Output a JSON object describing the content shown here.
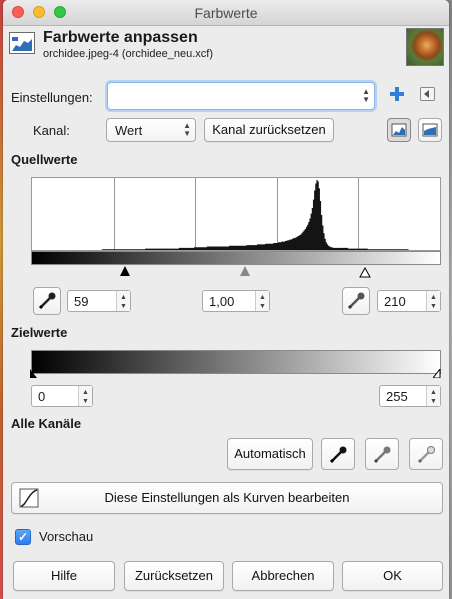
{
  "window": {
    "title": "Farbwerte"
  },
  "header": {
    "title": "Farbwerte anpassen",
    "subtitle": "orchidee.jpeg-4 (orchidee_neu.xcf)"
  },
  "settings": {
    "label": "Einstellungen:",
    "value": ""
  },
  "channel": {
    "label": "Kanal:",
    "value": "Wert",
    "reset_label": "Kanal zurücksetzen"
  },
  "source": {
    "title": "Quellwerte",
    "low": "59",
    "gamma": "1,00",
    "high": "210",
    "histogram": [
      0,
      0,
      0,
      0,
      0,
      0,
      0,
      0,
      0,
      0,
      0,
      0,
      0,
      0,
      0,
      0,
      0,
      0,
      0,
      0,
      0,
      0,
      0,
      0,
      0,
      0,
      0,
      0,
      0,
      0,
      0,
      0,
      0,
      0,
      0,
      0,
      0,
      0,
      0,
      0,
      0,
      0,
      0,
      0,
      0,
      0,
      0,
      0,
      0,
      0,
      0,
      0,
      0,
      0,
      0,
      0,
      0,
      0,
      0,
      0,
      1,
      1,
      1,
      1,
      1,
      1,
      1,
      1,
      1,
      1,
      1,
      1,
      1,
      1,
      1,
      1,
      1,
      1,
      1,
      1,
      1,
      1,
      1,
      1,
      1,
      1,
      1,
      1,
      1,
      1,
      1,
      1,
      1,
      1,
      1,
      1,
      1,
      2,
      2,
      2,
      2,
      2,
      2,
      2,
      2,
      2,
      2,
      2,
      2,
      2,
      2,
      2,
      2,
      2,
      2,
      2,
      2,
      2,
      2,
      2,
      2,
      2,
      2,
      2,
      2,
      2,
      3,
      3,
      3,
      3,
      3,
      3,
      3,
      3,
      3,
      3,
      3,
      3,
      3,
      4,
      4,
      4,
      4,
      4,
      4,
      4,
      4,
      4,
      4,
      4,
      5,
      5,
      5,
      5,
      5,
      5,
      5,
      5,
      5,
      5,
      5,
      5,
      5,
      5,
      5,
      5,
      5,
      5,
      5,
      6,
      6,
      6,
      6,
      6,
      6,
      6,
      6,
      6,
      6,
      6,
      6,
      6,
      6,
      6,
      7,
      7,
      7,
      7,
      7,
      7,
      7,
      7,
      7,
      8,
      8,
      8,
      8,
      8,
      8,
      8,
      9,
      9,
      9,
      9,
      9,
      9,
      9,
      10,
      10,
      10,
      10,
      11,
      11,
      11,
      12,
      12,
      12,
      13,
      13,
      14,
      14,
      15,
      15,
      16,
      17,
      17,
      18,
      19,
      20,
      21,
      22,
      24,
      26,
      28,
      30,
      33,
      36,
      40,
      45,
      52,
      60,
      72,
      85,
      95,
      100,
      98,
      88,
      70,
      50,
      35,
      24,
      16,
      11,
      8,
      6,
      5,
      4,
      4,
      3,
      3,
      3,
      3,
      3,
      3,
      3,
      3,
      3,
      3,
      3,
      3,
      3,
      2,
      2,
      2,
      2,
      2,
      2,
      2,
      2,
      2,
      2,
      2,
      2,
      2,
      2,
      2,
      2,
      2,
      1,
      1,
      1,
      1,
      1,
      1,
      1,
      1,
      1,
      1,
      1,
      1,
      1,
      1,
      1,
      1,
      1,
      1,
      1,
      1,
      1,
      1,
      1,
      1,
      1,
      1,
      1,
      1,
      1,
      1,
      1,
      1,
      1,
      1,
      1,
      0,
      0,
      0,
      0,
      0,
      0,
      0,
      0,
      0,
      0,
      0,
      0,
      0,
      0,
      0,
      0,
      0,
      0,
      0,
      0,
      0,
      0,
      0,
      0,
      0,
      0,
      0
    ]
  },
  "target": {
    "title": "Zielwerte",
    "low": "0",
    "high": "255"
  },
  "all_channels": {
    "title": "Alle Kanäle",
    "auto_label": "Automatisch"
  },
  "curves_label": "Diese Einstellungen als Kurven bearbeiten",
  "preview": {
    "label": "Vorschau",
    "checked": true
  },
  "footer": {
    "help": "Hilfe",
    "reset": "Zurücksetzen",
    "cancel": "Abbrechen",
    "ok": "OK"
  },
  "colors": {
    "accent": "#2a7ef0",
    "focus": "#b6d1f5"
  }
}
